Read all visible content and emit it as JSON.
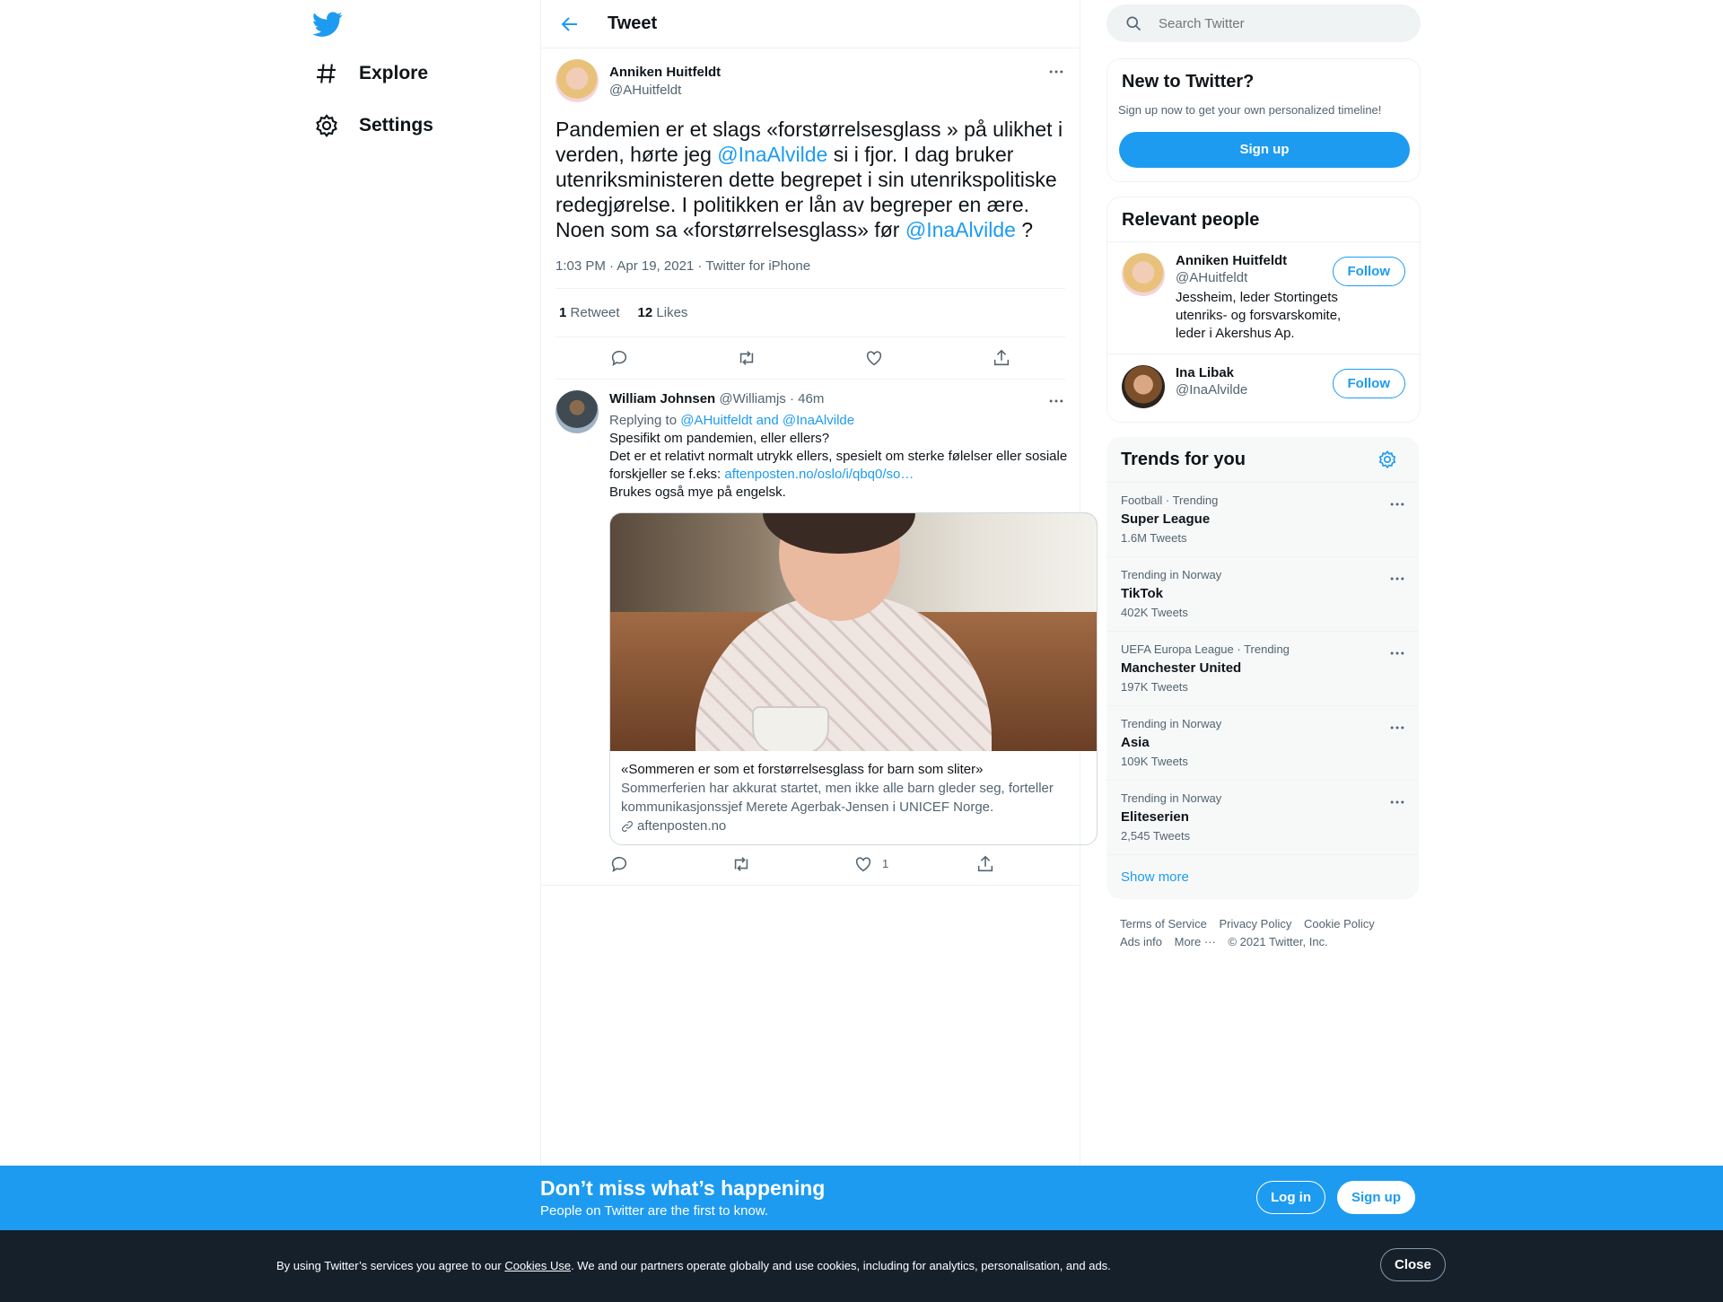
{
  "nav": {
    "explore": "Explore",
    "settings": "Settings"
  },
  "header": {
    "title": "Tweet"
  },
  "tweet": {
    "author_name": "Anniken Huitfeldt",
    "author_handle": "@AHuitfeldt",
    "text_1": "Pandemien er et slags «forstørrelsesglass » på ulikhet i verden, hørte jeg ",
    "mention_1": "@InaAlvilde",
    "text_2": " si i fjor. I dag bruker utenriksministeren dette begrepet i sin utenrikspolitiske redegjørelse. I politikken er lån av begreper en ære. Noen som sa «forstørrelsesglass» før ",
    "mention_2": "@InaAlvilde",
    "text_3": " ?",
    "meta": "1:03 PM · Apr 19, 2021 · Twitter for iPhone",
    "retweets_count": "1",
    "retweets_label": "Retweet",
    "likes_count": "12",
    "likes_label": "Likes"
  },
  "reply": {
    "author_name": "William Johnsen",
    "author_handle": "@Williamjs",
    "time": "· 46m",
    "replying_to_label": "Replying to",
    "replying_to_users": "@AHuitfeldt and @InaAlvilde",
    "line_1": "Spesifikt om pandemien, eller ellers?",
    "line_2": "Det er et relativt normalt utrykk ellers, spesielt om sterke følelser eller sosiale forskjeller se f.eks: ",
    "link": "aftenposten.no/oslo/i/qbq0/so…",
    "line_3": "Brukes også mye på engelsk.",
    "card_title": "«Sommeren er som et forstørrelsesglass for barn som sliter»",
    "card_desc": "Sommerferien har akkurat startet, men ikke alle barn gleder seg, forteller kommunikasjonssjef Merete Agerbak-Jensen i UNICEF Norge.",
    "card_domain": "aftenposten.no",
    "like_count": "1"
  },
  "search": {
    "placeholder": "Search Twitter"
  },
  "new_to_twitter": {
    "title": "New to Twitter?",
    "subtitle": "Sign up now to get your own personalized timeline!",
    "signup": "Sign up"
  },
  "relevant_people": {
    "title": "Relevant people",
    "people": [
      {
        "name": "Anniken Huitfeldt",
        "handle": "@AHuitfeldt",
        "bio": "Jessheim, leder Stortingets utenriks- og forsvarskomite, leder i Akershus Ap.",
        "follow": "Follow"
      },
      {
        "name": "Ina Libak",
        "handle": "@InaAlvilde",
        "bio": "",
        "follow": "Follow"
      }
    ]
  },
  "trends": {
    "title": "Trends for you",
    "items": [
      {
        "context": "Football · Trending",
        "name": "Super League",
        "count": "1.6M Tweets"
      },
      {
        "context": "Trending in Norway",
        "name": "TikTok",
        "count": "402K Tweets"
      },
      {
        "context": "UEFA Europa League · Trending",
        "name": "Manchester United",
        "count": "197K Tweets"
      },
      {
        "context": "Trending in Norway",
        "name": "Asia",
        "count": "109K Tweets"
      },
      {
        "context": "Trending in Norway",
        "name": "Eliteserien",
        "count": "2,545 Tweets"
      }
    ],
    "show_more": "Show more"
  },
  "footer": {
    "terms": "Terms of Service",
    "privacy": "Privacy Policy",
    "cookie": "Cookie Policy",
    "ads": "Ads info",
    "more": "More ···",
    "copyright": "© 2021 Twitter, Inc."
  },
  "banner": {
    "title": "Don’t miss what’s happening",
    "subtitle": "People on Twitter are the first to know.",
    "login": "Log in",
    "signup": "Sign up"
  },
  "cookie": {
    "text_before": "By using Twitter’s services you agree to our ",
    "link": "Cookies Use",
    "text_after": ". We and our partners operate globally and use cookies, including for analytics, personalisation, and ads.",
    "close": "Close"
  },
  "colors": {
    "accent": "#1d9bf0",
    "text": "#0f1419",
    "muted": "#536471",
    "cookie_bg": "#15202b"
  }
}
